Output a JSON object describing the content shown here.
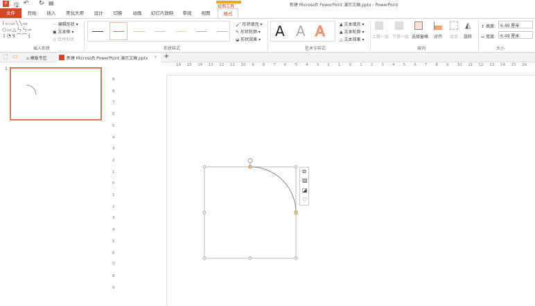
{
  "window": {
    "title": "新建 Microsoft PowerPoint 演示文稿.pptx - PowerPoint",
    "contextual_tab_group": "绘图工具"
  },
  "tabs": [
    {
      "label": "文件"
    },
    {
      "label": "开始"
    },
    {
      "label": "插入"
    },
    {
      "label": "美化大师"
    },
    {
      "label": "设计"
    },
    {
      "label": "切换"
    },
    {
      "label": "动画"
    },
    {
      "label": "幻灯片放映"
    },
    {
      "label": "审阅"
    },
    {
      "label": "视图"
    },
    {
      "label": "格式"
    }
  ],
  "ribbon": {
    "insert_shapes": {
      "label": "插入形状",
      "edit_shape": "编辑形状",
      "text_box": "文本框",
      "merge_shapes": "合并形状"
    },
    "shape_styles": {
      "label": "形状样式",
      "fill": "形状填充",
      "outline": "形状轮廓",
      "effects": "形状效果"
    },
    "wordart": {
      "label": "艺术字样式",
      "sample": "A",
      "fill": "文本填充",
      "outline": "文本轮廓",
      "effects": "文本效果"
    },
    "arrange": {
      "label": "排列",
      "bring_forward": "上移一层",
      "send_backward": "下移一层",
      "selection_pane": "选择窗格",
      "align": "对齐",
      "group": "组合",
      "rotate": "旋转"
    },
    "size": {
      "label": "大小",
      "height_label": "高度:",
      "height_value": "6.49 厘米",
      "width_label": "宽度:",
      "width_value": "6.49 厘米"
    }
  },
  "doc_tabs": {
    "template": "模板专区",
    "doc": "新建 Microsoft PowerPoint 演示文稿.pptx",
    "close": "×",
    "add": "+"
  },
  "slides": [
    {
      "number": "1"
    }
  ],
  "ruler": {
    "h": [
      "16",
      "15",
      "14",
      "13",
      "12",
      "11",
      "10",
      "9",
      "8",
      "7",
      "6",
      "5",
      "4",
      "3",
      "2",
      "1",
      "0",
      "1",
      "2",
      "3",
      "4",
      "5",
      "6",
      "7",
      "8",
      "9",
      "10",
      "11",
      "12",
      "13",
      "14",
      "15",
      "16"
    ],
    "v": [
      "9",
      "8",
      "7",
      "6",
      "5",
      "4",
      "3",
      "2",
      "1",
      "0",
      "1",
      "2",
      "3",
      "4",
      "5",
      "6",
      "7",
      "8",
      "9"
    ]
  },
  "colors": {
    "accent": "#d24726"
  }
}
